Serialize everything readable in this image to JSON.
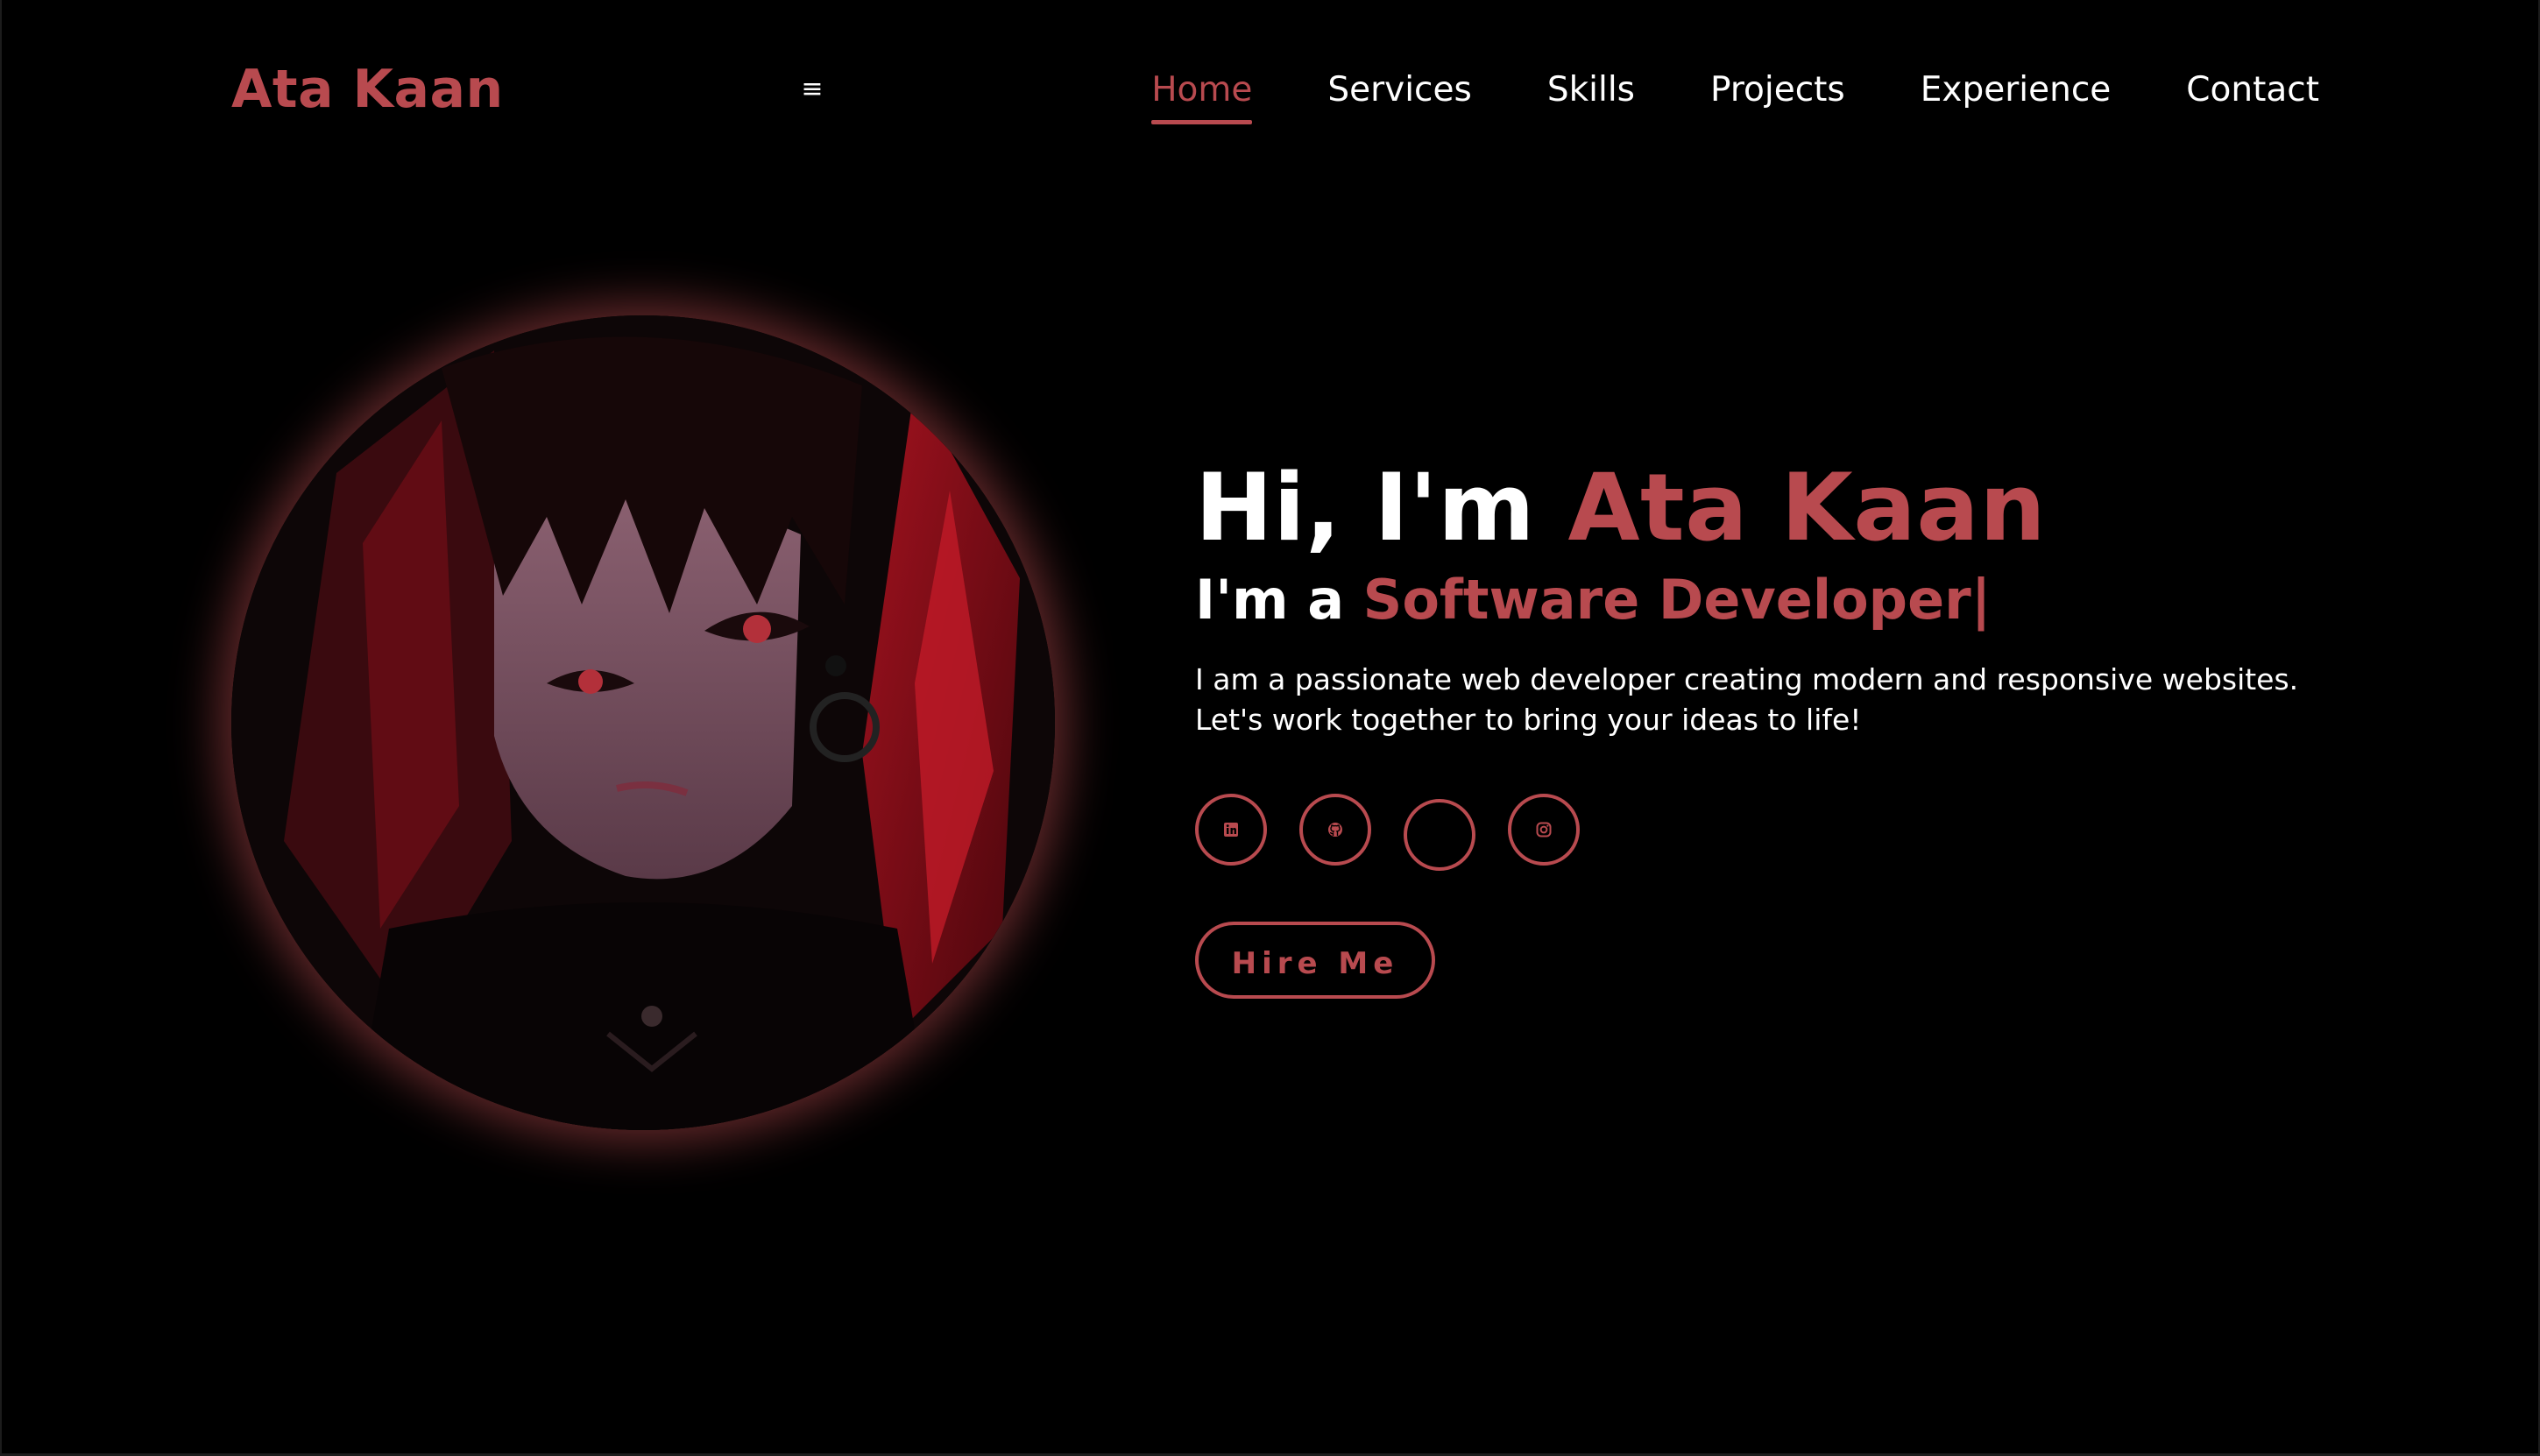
{
  "header": {
    "logo": "Ata Kaan",
    "menu_toggle": "≡",
    "nav": [
      {
        "label": "Home",
        "active": true
      },
      {
        "label": "Services",
        "active": false
      },
      {
        "label": "Skills",
        "active": false
      },
      {
        "label": "Projects",
        "active": false
      },
      {
        "label": "Experience",
        "active": false
      },
      {
        "label": "Contact",
        "active": false
      }
    ]
  },
  "hero": {
    "greeting_prefix": "Hi, I'm ",
    "name": "Ata Kaan",
    "role_prefix": "I'm a ",
    "role": "Software Developer|",
    "description": "I am a passionate web developer creating modern and responsive websites. Let's work together to bring your ideas to life!",
    "cta_label": "Hire Me"
  },
  "socials": [
    {
      "icon": "linkedin-icon"
    },
    {
      "icon": "github-icon"
    },
    {
      "icon": "empty-icon"
    },
    {
      "icon": "instagram-icon"
    }
  ],
  "colors": {
    "background": "#000000",
    "accent": "#b84a4f",
    "text": "#ffffff"
  }
}
